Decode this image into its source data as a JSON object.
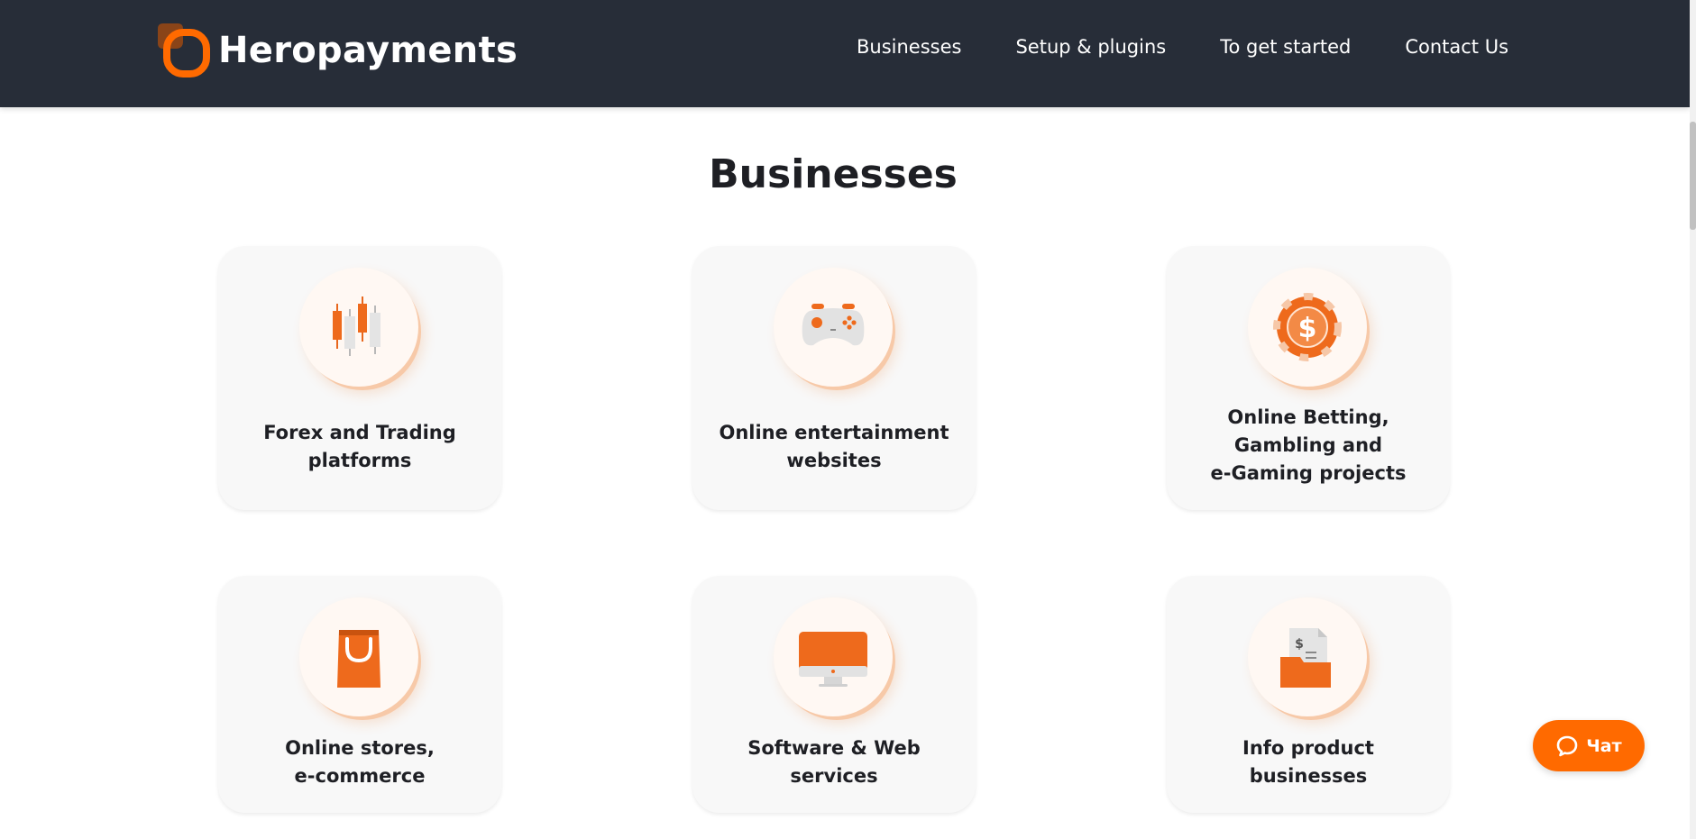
{
  "header": {
    "brand": "Heropayments",
    "nav": [
      {
        "label": "Businesses"
      },
      {
        "label": "Setup & plugins"
      },
      {
        "label": "To get started"
      },
      {
        "label": "Contact Us"
      }
    ]
  },
  "main": {
    "title": "Businesses",
    "cards": [
      {
        "icon": "candlestick-chart-icon",
        "label_lines": [
          "Forex and Trading",
          "platforms"
        ]
      },
      {
        "icon": "gamepad-icon",
        "label_lines": [
          "Online entertainment",
          "websites"
        ]
      },
      {
        "icon": "casino-chip-icon",
        "label_lines": [
          "Online Betting,",
          "Gambling and",
          "e-Gaming projects"
        ]
      },
      {
        "icon": "shopping-bag-icon",
        "label_lines": [
          "Online stores,",
          "e-commerce"
        ]
      },
      {
        "icon": "monitor-icon",
        "label_lines": [
          "Software & Web",
          "services"
        ]
      },
      {
        "icon": "document-folder-icon",
        "label_lines": [
          "Info product",
          "businesses"
        ]
      }
    ]
  },
  "chat": {
    "label": "Чат",
    "icon": "chat-bubble-icon"
  },
  "colors": {
    "accent": "#ff6a00",
    "header_bg": "#272d38",
    "card_bg": "#f8f8f8"
  }
}
